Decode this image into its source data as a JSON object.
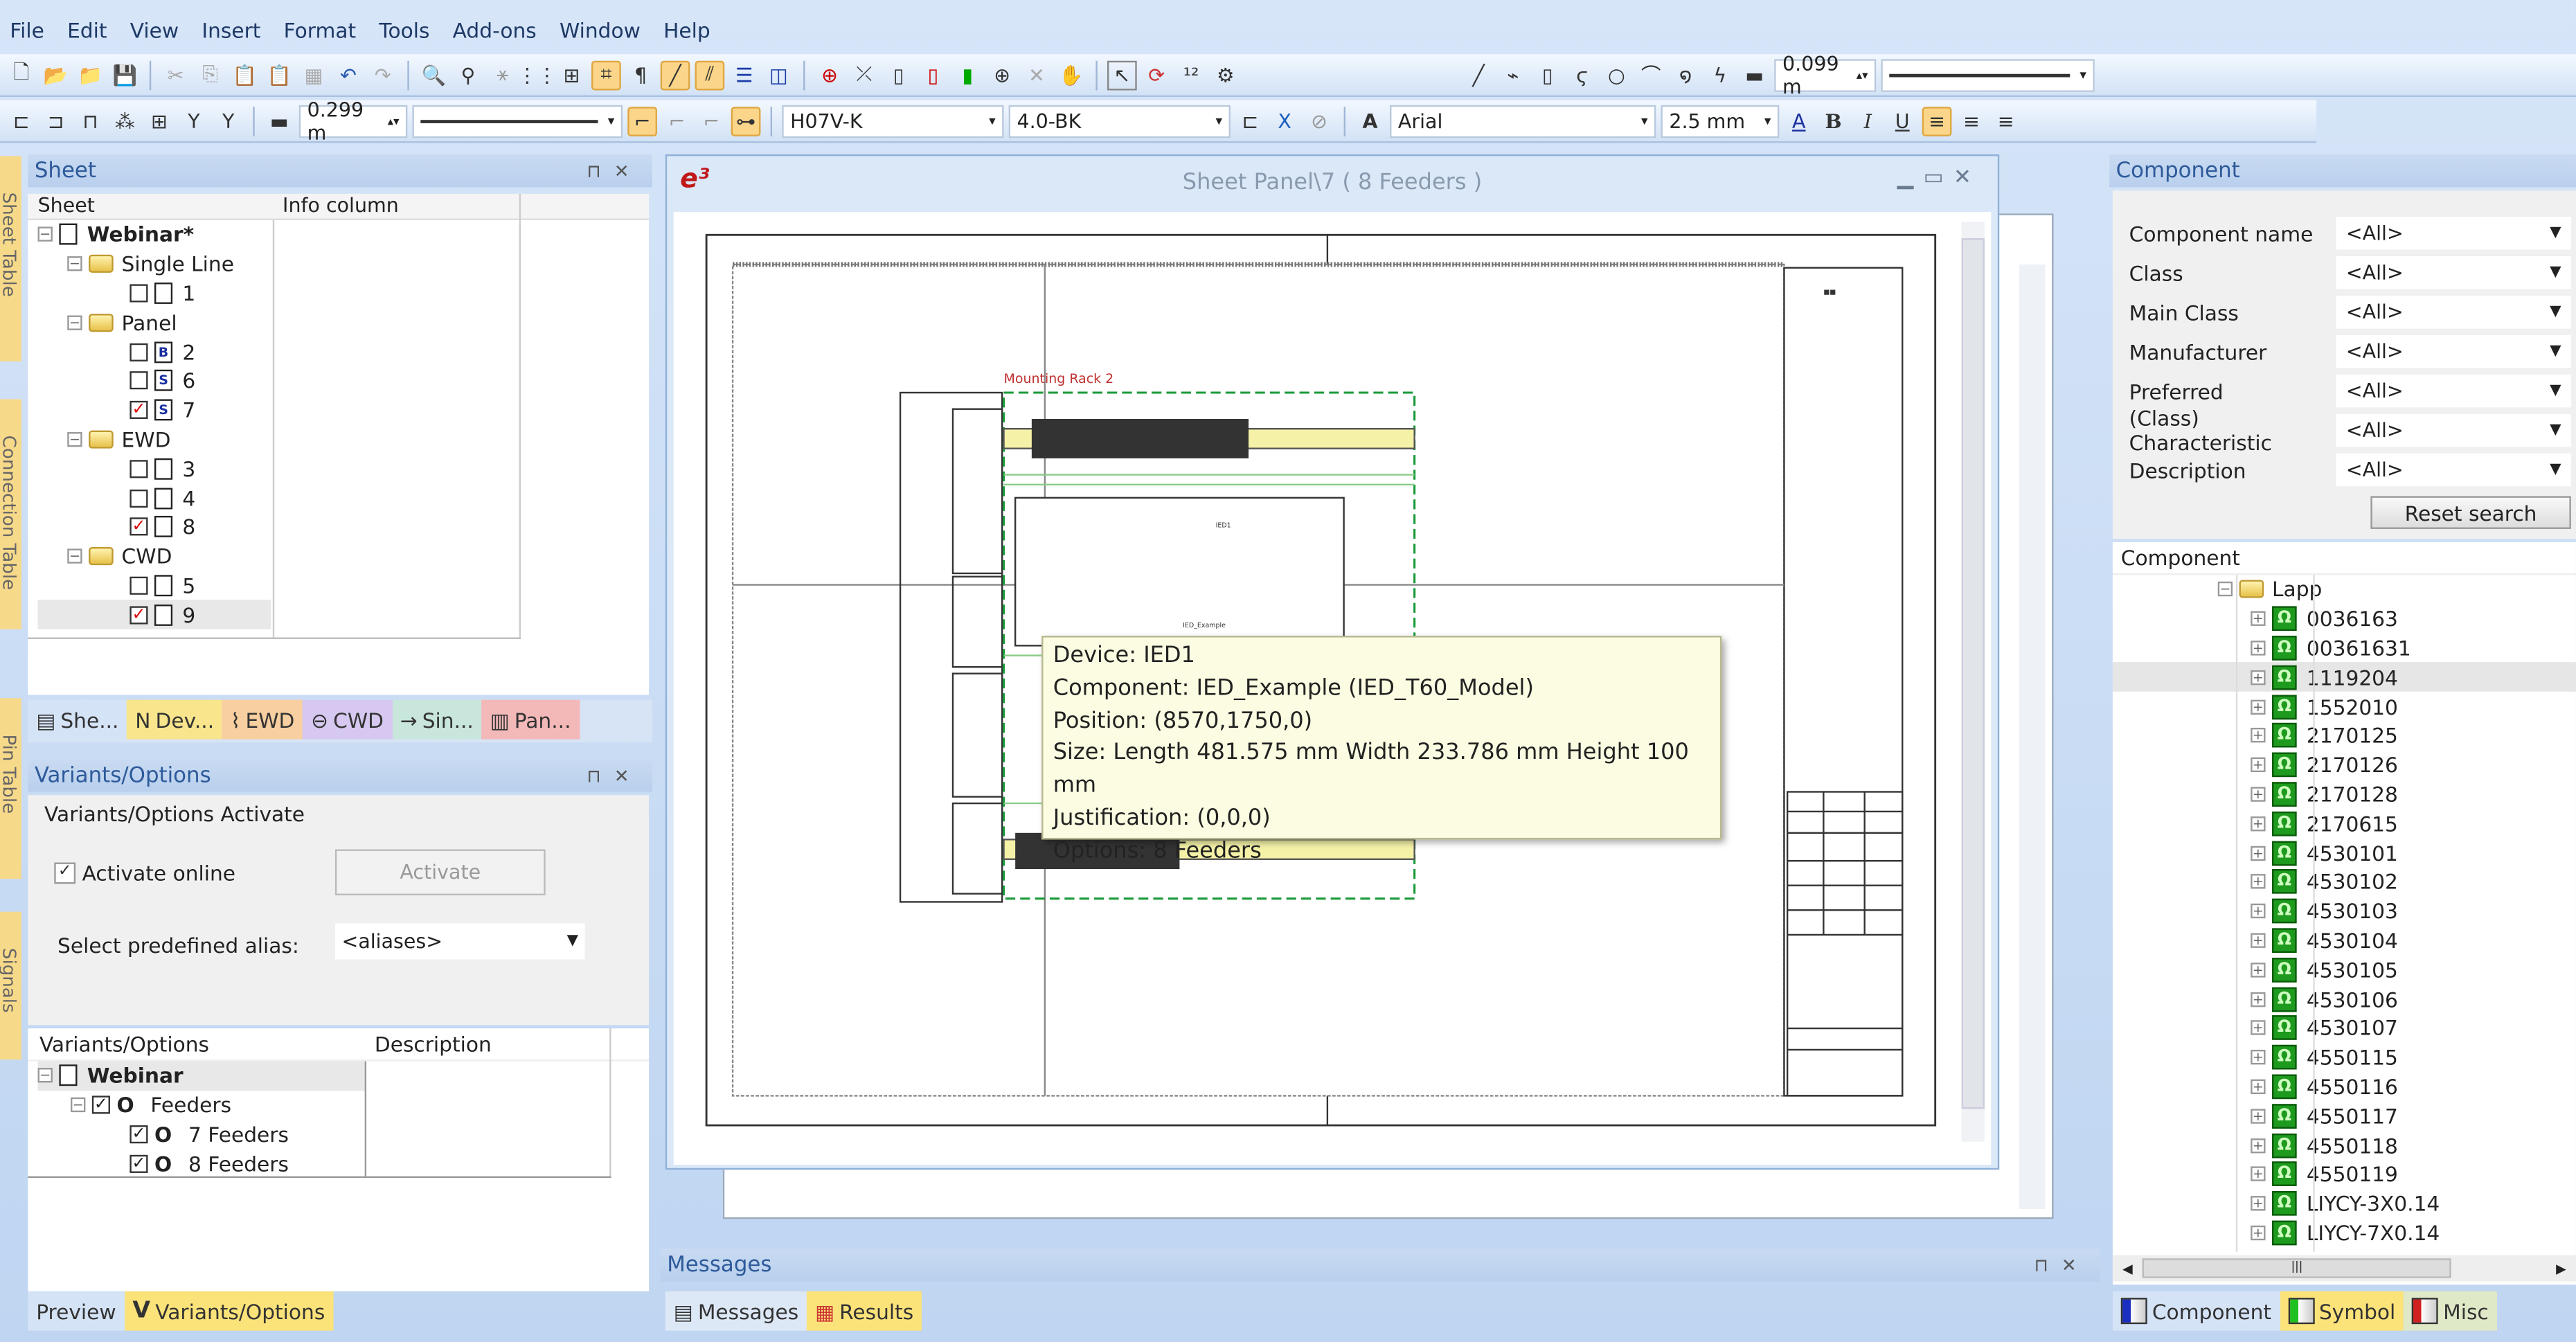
{
  "menu": [
    "File",
    "Edit",
    "View",
    "Insert",
    "Format",
    "Tools",
    "Add-ons",
    "Window",
    "Help"
  ],
  "toolbar": {
    "line_width_1": "0.299 m",
    "wire_type": "H07V-K",
    "wire_color": "4.0-BK",
    "font": "Arial",
    "font_size": "2.5 mm",
    "line_width_2": "0.099 m",
    "bold": "B",
    "italic": "I",
    "underline": "U",
    "text_a": "A"
  },
  "side_tabs": [
    "Sheet Table",
    "Connection Table",
    "Pin Table",
    "Signals"
  ],
  "sheet_panel": {
    "title": "Sheet",
    "col_sheet": "Sheet",
    "col_info": "Info column",
    "project": "Webinar*",
    "folders": [
      {
        "name": "Single Line",
        "sheets": [
          {
            "n": "1",
            "checked": false,
            "icon": ""
          }
        ]
      },
      {
        "name": "Panel",
        "sheets": [
          {
            "n": "2",
            "checked": false,
            "icon": "B"
          },
          {
            "n": "6",
            "checked": false,
            "icon": "S"
          },
          {
            "n": "7",
            "checked": true,
            "icon": "S"
          }
        ]
      },
      {
        "name": "EWD",
        "sheets": [
          {
            "n": "3",
            "checked": false,
            "icon": ""
          },
          {
            "n": "4",
            "checked": false,
            "icon": ""
          },
          {
            "n": "8",
            "checked": true,
            "icon": ""
          }
        ]
      },
      {
        "name": "CWD",
        "sheets": [
          {
            "n": "5",
            "checked": false,
            "icon": ""
          },
          {
            "n": "9",
            "checked": true,
            "icon": ""
          }
        ]
      }
    ],
    "tabs": [
      "She...",
      "Dev...",
      "EWD",
      "CWD",
      "Sin...",
      "Pan..."
    ]
  },
  "variants_panel": {
    "title": "Variants/Options",
    "group": "Variants/Options Activate",
    "activate_online": "Activate online",
    "activate_online_checked": true,
    "activate_btn": "Activate",
    "alias_label": "Select predefined alias:",
    "alias_value": "<aliases>",
    "col_options": "Variants/Options",
    "col_desc": "Description",
    "root": "Webinar",
    "option_letter": "O",
    "items": [
      "Feeders",
      "7 Feeders",
      "8 Feeders"
    ],
    "tabs": [
      "Preview",
      "Variants/Options"
    ]
  },
  "document": {
    "title": "Sheet Panel\\7 ( 8 Feeders )",
    "rack_label": "Mounting Rack 2"
  },
  "tooltip": [
    "Device: IED1",
    "Component: IED_Example (IED_T60_Model)",
    "Position: (8570,1750,0)",
    "Size: Length 481.575 mm Width 233.786 mm Height 100 mm",
    "Justification: (0,0,0)",
    "Options: 8 Feeders"
  ],
  "messages": {
    "title": "Messages",
    "tabs": [
      "Messages",
      "Results"
    ]
  },
  "component_panel": {
    "title": "Component",
    "filters": [
      {
        "label": "Component name",
        "value": "<All>"
      },
      {
        "label": "Class",
        "value": "<All>"
      },
      {
        "label": "Main Class",
        "value": "<All>"
      },
      {
        "label": "Manufacturer",
        "value": "<All>"
      },
      {
        "label": "Preferred",
        "value": "<All>"
      },
      {
        "label": "(Class) Characteristic",
        "value": "<All>"
      },
      {
        "label": "Description",
        "value": "<All>"
      }
    ],
    "reset": "Reset search",
    "tree_header": "Component",
    "manufacturer": "Lapp",
    "items": [
      "0036163",
      "00361631",
      "1119204",
      "1552010",
      "2170125",
      "2170126",
      "2170128",
      "2170615",
      "4530101",
      "4530102",
      "4530103",
      "4530104",
      "4530105",
      "4530106",
      "4530107",
      "4550115",
      "4550116",
      "4550117",
      "4550118",
      "4550119",
      "LIYCY-3X0.14",
      "LIYCY-7X0.14"
    ],
    "selected": "1119204",
    "tabs": [
      "Component",
      "Symbol",
      "Misc"
    ]
  }
}
